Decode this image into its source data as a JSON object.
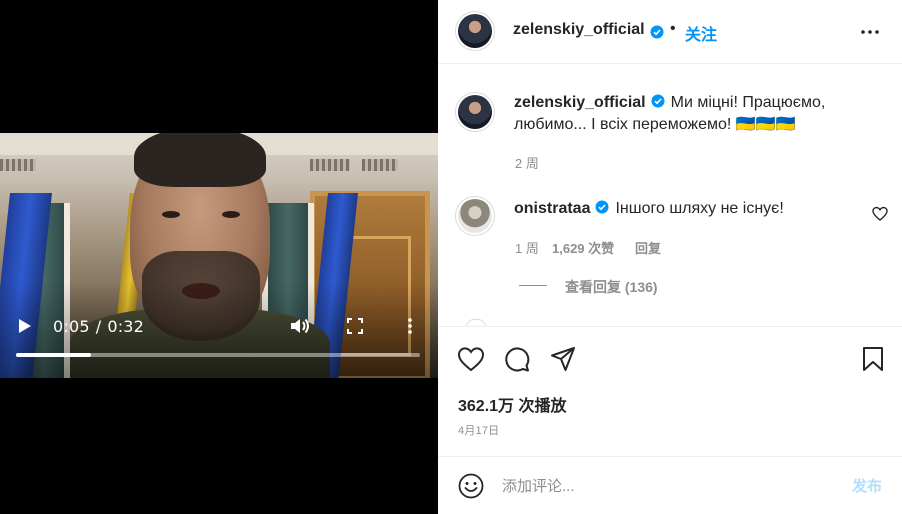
{
  "video": {
    "current_time": "0:05",
    "duration": "0:32",
    "time_separator": "/",
    "progress_fraction": 0.185
  },
  "post": {
    "author": "zelenskiy_official",
    "follow_label": "关注",
    "dot": "•",
    "caption": "Ми міцні! Працюємо, любимо... І всіх переможемо! 🇺🇦🇺🇦🇺🇦",
    "caption_time": "2 周",
    "plays": "362.1万 次播放",
    "date": "4月17日"
  },
  "comment": {
    "author": "onistrataa",
    "text": "Іншого шляху не існує!",
    "time": "1 周",
    "likes": "1,629 次赞",
    "reply_label": "回复",
    "view_replies": "查看回复 (136)"
  },
  "composer": {
    "placeholder": "添加评论...",
    "post_label": "发布"
  },
  "colors": {
    "accent": "#0095f6",
    "post_disabled": "#b2dffc",
    "secondary_text": "#8e8e8e"
  },
  "icons": [
    "play-icon",
    "volume-icon",
    "fullscreen-icon",
    "more-vertical-icon",
    "verified-badge-icon",
    "more-horizontal-icon",
    "heart-icon",
    "comment-icon",
    "share-icon",
    "bookmark-icon",
    "emoji-icon"
  ]
}
